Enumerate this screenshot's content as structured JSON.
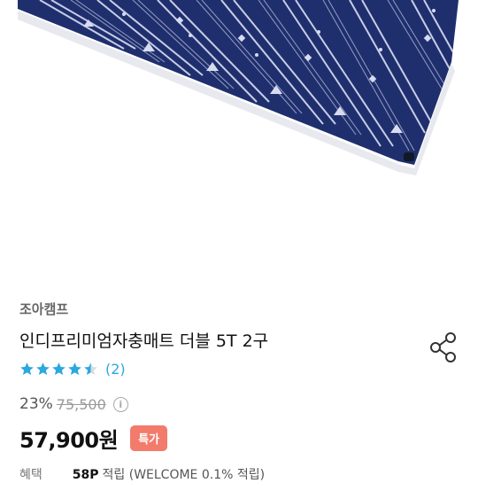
{
  "product": {
    "brand": "조아캠프",
    "title": "인디프리미엄자충매트 더블 5T 2구",
    "rating": 4.5,
    "review_count": "(2)",
    "discount_rate": "23%",
    "original_price": "75,500",
    "price": "57,900원",
    "badge": "특가",
    "benefit_label": "혜택",
    "benefit_points": "58P",
    "benefit_text": "적립 (WELCOME 0.1% 적립)"
  },
  "icons": {
    "share": "share-icon",
    "info": "info-icon",
    "star": "star-icon"
  },
  "colors": {
    "star": "#2ba8e0",
    "badge": "#f27b6b",
    "mat": "#1f2f6e"
  }
}
